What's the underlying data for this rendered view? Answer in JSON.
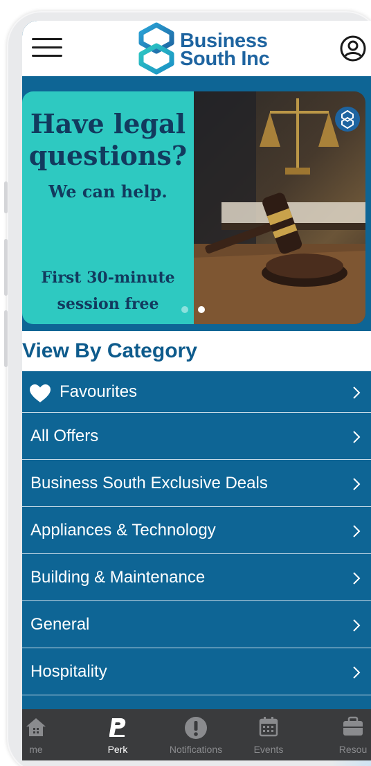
{
  "header": {
    "brand_line1": "Business",
    "brand_line2": "South Inc",
    "menu_icon": "hamburger-menu-icon",
    "profile_icon": "user-profile-icon"
  },
  "banner": {
    "headline": "Have legal questions?",
    "subheadline": "We can help.",
    "offer": "First 30-minute session free",
    "slide_count": 2,
    "active_slide": 2,
    "colors": {
      "panel": "#2ec9c1",
      "text": "#123a5e"
    }
  },
  "section": {
    "title": "View By Category"
  },
  "categories": [
    {
      "label": "Favourites",
      "icon": "heart-icon"
    },
    {
      "label": "All Offers"
    },
    {
      "label": "Business South Exclusive Deals"
    },
    {
      "label": "Appliances & Technology"
    },
    {
      "label": "Building & Maintenance"
    },
    {
      "label": "General"
    },
    {
      "label": "Hospitality"
    },
    {
      "label": ""
    }
  ],
  "bottom_nav": [
    {
      "label": "me",
      "icon": "home-icon"
    },
    {
      "label": "Perk",
      "icon": "perk-icon",
      "active": true
    },
    {
      "label": "Notifications",
      "icon": "alert-icon"
    },
    {
      "label": "Events",
      "icon": "calendar-icon"
    },
    {
      "label": "Resou",
      "icon": "briefcase-icon"
    }
  ],
  "colors": {
    "brand_blue": "#0e6595",
    "title_blue": "#0e5b8c",
    "nav_bg": "#3a3b3d",
    "teal": "#2ec9c1"
  }
}
